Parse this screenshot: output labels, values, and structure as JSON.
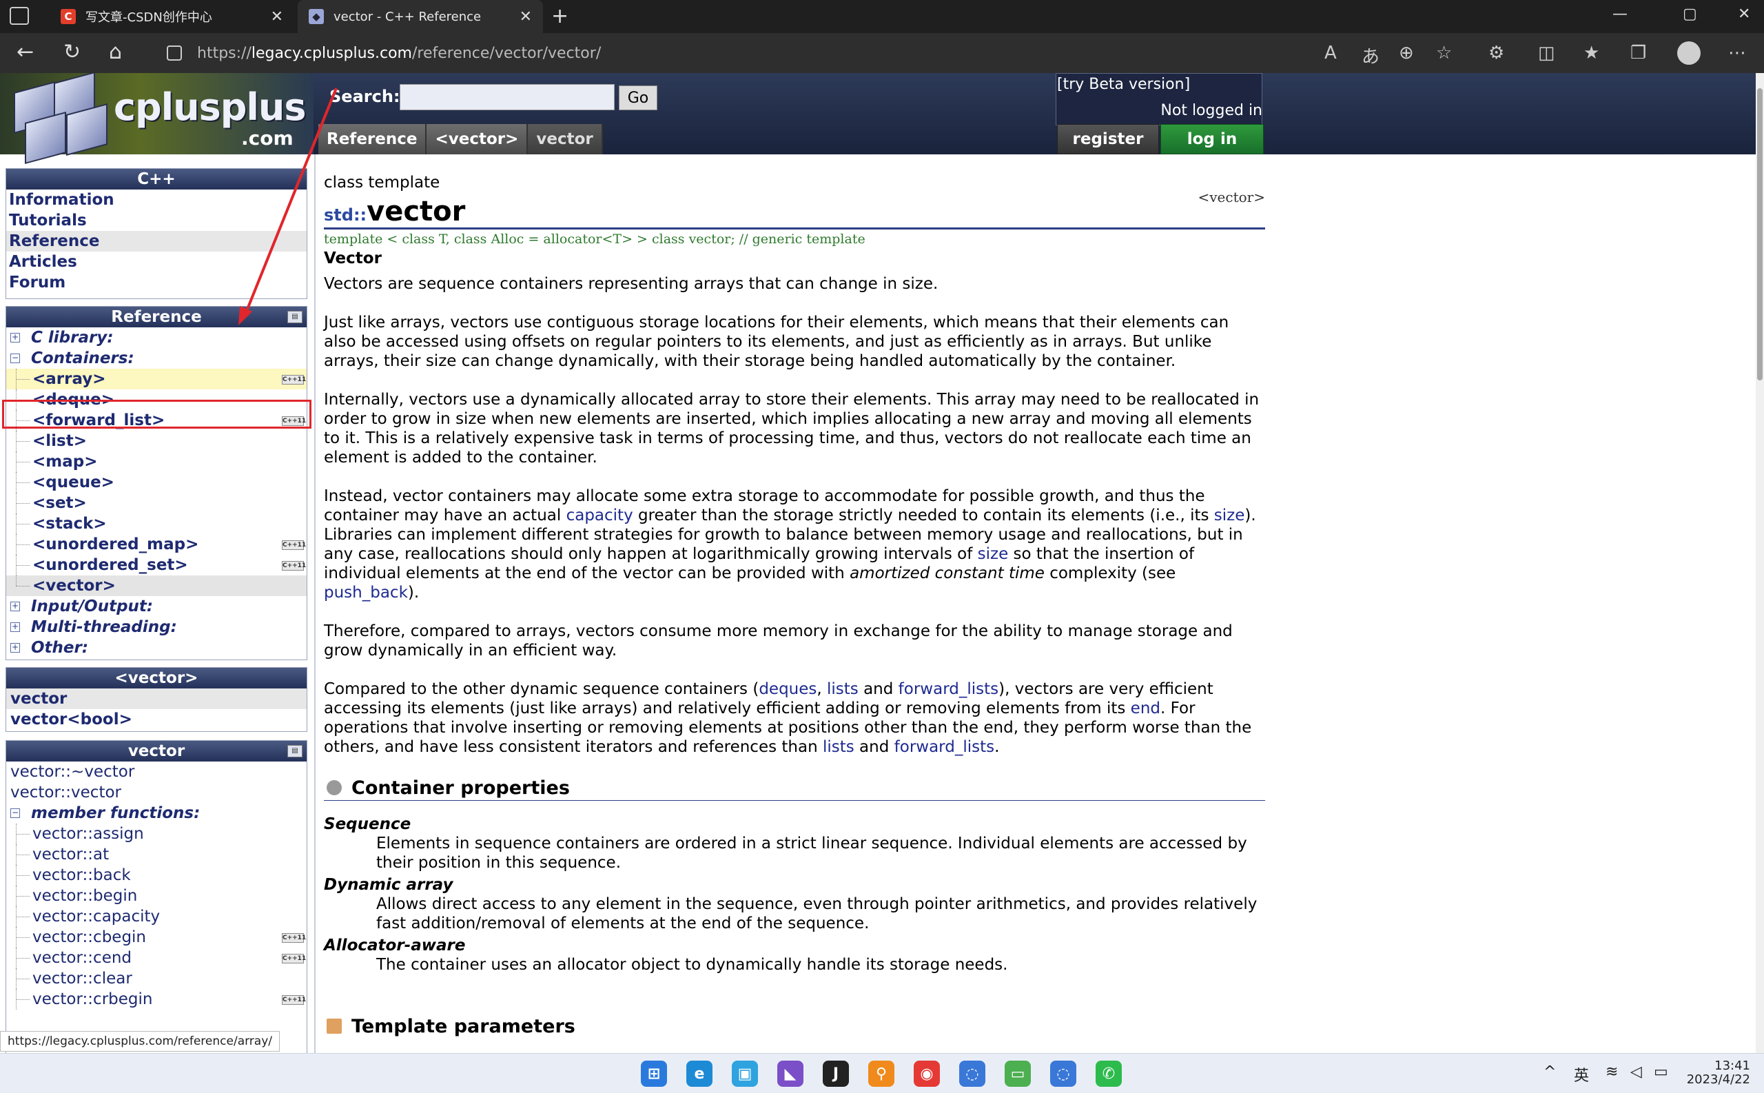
{
  "browser": {
    "tabs": [
      {
        "label": "写文章-CSDN创作中心",
        "favicon": "csdn-icon",
        "active": false
      },
      {
        "label": "vector - C++ Reference",
        "favicon": "cplusplus-icon",
        "active": true
      }
    ],
    "url_prefix": "https://",
    "url_domain": "legacy.cplusplus.com",
    "url_path": "/reference/vector/vector/",
    "status_url": "https://legacy.cplusplus.com/reference/array/"
  },
  "site": {
    "logo_text": "cplusplus",
    "logo_suffix": ".com",
    "search_label": "Search:",
    "search_value": "",
    "go_label": "Go",
    "beta_label": "[try Beta version]",
    "login_status": "Not logged in",
    "register_label": "register",
    "login_label": "log in",
    "breadcrumb": [
      "Reference",
      "<vector>",
      "vector"
    ]
  },
  "sidebar": {
    "cpp_box": {
      "title": "C++",
      "items": [
        "Information",
        "Tutorials",
        "Reference",
        "Articles",
        "Forum"
      ],
      "selected": "Reference"
    },
    "reference_box": {
      "title": "Reference",
      "categories": {
        "c_library": "C library:",
        "containers": "Containers:",
        "io": "Input/Output:",
        "threading": "Multi-threading:",
        "other": "Other:"
      },
      "containers": [
        {
          "label": "<array>",
          "cpp11": true
        },
        {
          "label": "<deque>",
          "cpp11": false
        },
        {
          "label": "<forward_list>",
          "cpp11": true
        },
        {
          "label": "<list>",
          "cpp11": false
        },
        {
          "label": "<map>",
          "cpp11": false
        },
        {
          "label": "<queue>",
          "cpp11": false
        },
        {
          "label": "<set>",
          "cpp11": false
        },
        {
          "label": "<stack>",
          "cpp11": false
        },
        {
          "label": "<unordered_map>",
          "cpp11": true
        },
        {
          "label": "<unordered_set>",
          "cpp11": true
        },
        {
          "label": "<vector>",
          "cpp11": false
        }
      ],
      "cpp11_badge": "C++11"
    },
    "vector_header_box": {
      "title": "<vector>",
      "items": [
        "vector",
        "vector<bool>"
      ]
    },
    "vector_box": {
      "title": "vector",
      "top_items": [
        "vector::~vector",
        "vector::vector"
      ],
      "member_group": "member functions:",
      "members": [
        {
          "label": "vector::assign",
          "cpp11": false
        },
        {
          "label": "vector::at",
          "cpp11": false
        },
        {
          "label": "vector::back",
          "cpp11": false
        },
        {
          "label": "vector::begin",
          "cpp11": false
        },
        {
          "label": "vector::capacity",
          "cpp11": false
        },
        {
          "label": "vector::cbegin",
          "cpp11": true
        },
        {
          "label": "vector::cend",
          "cpp11": true
        },
        {
          "label": "vector::clear",
          "cpp11": false
        },
        {
          "label": "vector::crbegin",
          "cpp11": true
        }
      ]
    }
  },
  "main": {
    "kind": "class template",
    "ns": "std::",
    "name": "vector",
    "header_tag": "<vector>",
    "prototype": "template < class T, class Alloc = allocator<T> > class vector; // generic template",
    "section_name": "Vector",
    "paragraphs": {
      "p1": "Vectors are sequence containers representing arrays that can change in size.",
      "p2": "Just like arrays, vectors use contiguous storage locations for their elements, which means that their elements can also be accessed using offsets on regular pointers to its elements, and just as efficiently as in arrays. But unlike arrays, their size can change dynamically, with their storage being handled automatically by the container.",
      "p3": "Internally, vectors use a dynamically allocated array to store their elements. This array may need to be reallocated in order to grow in size when new elements are inserted, which implies allocating a new array and moving all elements to it. This is a relatively expensive task in terms of processing time, and thus, vectors do not reallocate each time an element is added to the container.",
      "p4_a": "Instead, vector containers may allocate some extra storage to accommodate for possible growth, and thus the container may have an actual ",
      "p4_link1": "capacity",
      "p4_b": " greater than the storage strictly needed to contain its elements (i.e., its ",
      "p4_link2": "size",
      "p4_c": "). Libraries can implement different strategies for growth to balance between memory usage and reallocations, but in any case, reallocations should only happen at logarithmically growing intervals of ",
      "p4_link3": "size",
      "p4_d": " so that the insertion of individual elements at the end of the vector can be provided with ",
      "p4_em": "amortized constant time",
      "p4_e": " complexity (see ",
      "p4_link4": "push_back",
      "p4_f": ").",
      "p5": "Therefore, compared to arrays, vectors consume more memory in exchange for the ability to manage storage and grow dynamically in an efficient way.",
      "p6_a": "Compared to the other dynamic sequence containers (",
      "p6_link1": "deques",
      "p6_b": ", ",
      "p6_link2": "lists",
      "p6_c": " and ",
      "p6_link3": "forward_lists",
      "p6_d": "), vectors are very efficient accessing its elements (just like arrays) and relatively efficient adding or removing elements from its ",
      "p6_link4": "end",
      "p6_e": ". For operations that involve inserting or removing elements at positions other than the end, they perform worse than the others, and have less consistent iterators and references than ",
      "p6_link5": "lists",
      "p6_f": " and ",
      "p6_link6": "forward_lists",
      "p6_g": "."
    },
    "properties_heading": "Container properties",
    "properties": [
      {
        "term": "Sequence",
        "desc": "Elements in sequence containers are ordered in a strict linear sequence. Individual elements are accessed by their position in this sequence."
      },
      {
        "term": "Dynamic array",
        "desc": "Allows direct access to any element in the sequence, even through pointer arithmetics, and provides relatively fast addition/removal of elements at the end of the sequence."
      },
      {
        "term": "Allocator-aware",
        "desc": "The container uses an allocator object to dynamically handle its storage needs."
      }
    ],
    "template_heading": "Template parameters"
  },
  "taskbar": {
    "ime": "英",
    "time": "13:41",
    "date": "2023/4/22"
  },
  "colors": {
    "link": "#1e2a90",
    "annotation": "#e0262c",
    "header_bg": "#24315a",
    "login_green": "#1f7f30"
  }
}
